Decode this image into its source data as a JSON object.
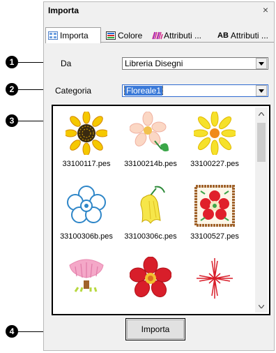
{
  "panel": {
    "title": "Importa",
    "close_glyph": "×"
  },
  "tabs": [
    {
      "label": "Importa",
      "icon": "import-tab-icon",
      "active": true
    },
    {
      "label": "Colore",
      "icon": "color-tab-icon",
      "active": false
    },
    {
      "label": "Attributi ...",
      "icon": "attributes-tab-icon",
      "active": false
    },
    {
      "label": "Attributi ...",
      "icon": "text-attributes-tab-icon",
      "active": false
    }
  ],
  "text_tab_icon_glyph": "AB",
  "fields": {
    "from_label": "Da",
    "from_value": "Libreria Disegni",
    "category_label": "Categoria",
    "category_value": "Floreale1"
  },
  "gallery": {
    "items": [
      {
        "file": "33100117.pes",
        "icon": "sunflower"
      },
      {
        "file": "33100214b.pes",
        "icon": "pink-daisy"
      },
      {
        "file": "33100227.pes",
        "icon": "yellow-daisy"
      },
      {
        "file": "33100306b.pes",
        "icon": "blue-outline-flower"
      },
      {
        "file": "33100306c.pes",
        "icon": "yellow-bellflower"
      },
      {
        "file": "33100527.pes",
        "icon": "framed-red-flower"
      },
      {
        "file": "",
        "icon": "pink-tulip"
      },
      {
        "file": "",
        "icon": "red-five-petal"
      },
      {
        "file": "",
        "icon": "red-star-stitch"
      }
    ]
  },
  "import_button": "Importa",
  "callouts": [
    "1",
    "2",
    "3",
    "4"
  ],
  "colors": {
    "accent": "#3a79d8",
    "panel_bg": "#f0f0f0",
    "button_bg": "#e1e1e1"
  }
}
